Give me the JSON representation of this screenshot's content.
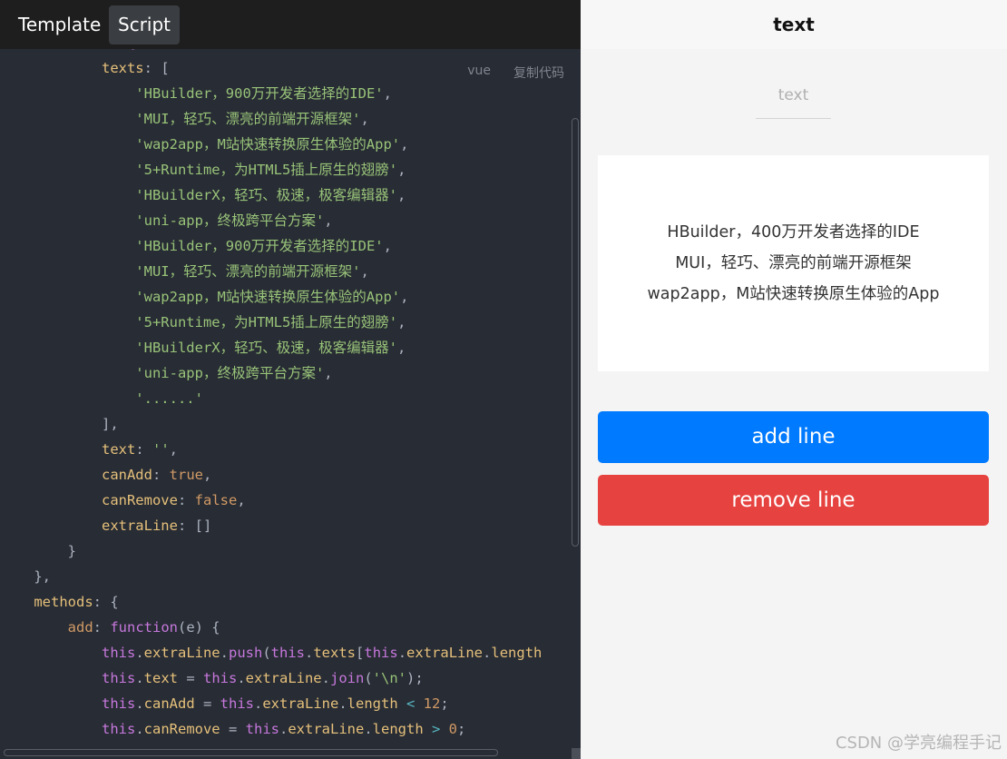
{
  "tabs": [
    {
      "label": "Template",
      "active": false
    },
    {
      "label": "Script",
      "active": true
    }
  ],
  "code_meta": {
    "language": "vue",
    "copy_label": "复制代码"
  },
  "code": {
    "lines": [
      [
        [
          "        return {",
          "tk-kw"
        ]
      ],
      [
        [
          "            ",
          ""
        ],
        [
          "texts",
          "tk-key"
        ],
        [
          ": [",
          "tk-punc"
        ]
      ],
      [
        [
          "                'HBuilder，900万开发者选择的IDE'",
          "tk-str"
        ],
        [
          ",",
          "tk-punc"
        ]
      ],
      [
        [
          "                'MUI，轻巧、漂亮的前端开源框架'",
          "tk-str"
        ],
        [
          ",",
          "tk-punc"
        ]
      ],
      [
        [
          "                'wap2app，M站快速转换原生体验的App'",
          "tk-str"
        ],
        [
          ",",
          "tk-punc"
        ]
      ],
      [
        [
          "                '5+Runtime，为HTML5插上原生的翅膀'",
          "tk-str"
        ],
        [
          ",",
          "tk-punc"
        ]
      ],
      [
        [
          "                'HBuilderX，轻巧、极速，极客编辑器'",
          "tk-str"
        ],
        [
          ",",
          "tk-punc"
        ]
      ],
      [
        [
          "                'uni-app，终极跨平台方案'",
          "tk-str"
        ],
        [
          ",",
          "tk-punc"
        ]
      ],
      [
        [
          "                'HBuilder，900万开发者选择的IDE'",
          "tk-str"
        ],
        [
          ",",
          "tk-punc"
        ]
      ],
      [
        [
          "                'MUI，轻巧、漂亮的前端开源框架'",
          "tk-str"
        ],
        [
          ",",
          "tk-punc"
        ]
      ],
      [
        [
          "                'wap2app，M站快速转换原生体验的App'",
          "tk-str"
        ],
        [
          ",",
          "tk-punc"
        ]
      ],
      [
        [
          "                '5+Runtime，为HTML5插上原生的翅膀'",
          "tk-str"
        ],
        [
          ",",
          "tk-punc"
        ]
      ],
      [
        [
          "                'HBuilderX，轻巧、极速，极客编辑器'",
          "tk-str"
        ],
        [
          ",",
          "tk-punc"
        ]
      ],
      [
        [
          "                'uni-app，终极跨平台方案'",
          "tk-str"
        ],
        [
          ",",
          "tk-punc"
        ]
      ],
      [
        [
          "                '......'",
          "tk-str"
        ]
      ],
      [
        [
          "            ],",
          "tk-punc"
        ]
      ],
      [
        [
          "            ",
          ""
        ],
        [
          "text",
          "tk-key"
        ],
        [
          ": ",
          "tk-punc"
        ],
        [
          "''",
          "tk-str"
        ],
        [
          ",",
          "tk-punc"
        ]
      ],
      [
        [
          "            ",
          ""
        ],
        [
          "canAdd",
          "tk-key"
        ],
        [
          ": ",
          "tk-punc"
        ],
        [
          "true",
          "tk-bool"
        ],
        [
          ",",
          "tk-punc"
        ]
      ],
      [
        [
          "            ",
          ""
        ],
        [
          "canRemove",
          "tk-key"
        ],
        [
          ": ",
          "tk-punc"
        ],
        [
          "false",
          "tk-bool"
        ],
        [
          ",",
          "tk-punc"
        ]
      ],
      [
        [
          "            ",
          ""
        ],
        [
          "extraLine",
          "tk-key"
        ],
        [
          ": []",
          "tk-punc"
        ]
      ],
      [
        [
          "        }",
          "tk-punc"
        ]
      ],
      [
        [
          "    },",
          "tk-punc"
        ]
      ],
      [
        [
          "    ",
          ""
        ],
        [
          "methods",
          "tk-key"
        ],
        [
          ": {",
          "tk-punc"
        ]
      ],
      [
        [
          "        ",
          ""
        ],
        [
          "add",
          "tk-meth"
        ],
        [
          ": ",
          "tk-punc"
        ],
        [
          "function",
          "tk-kw"
        ],
        [
          "(e) {",
          "tk-punc"
        ]
      ],
      [
        [
          "            ",
          ""
        ],
        [
          "this",
          "tk-kw"
        ],
        [
          ".",
          "tk-punc"
        ],
        [
          "extraLine",
          "tk-prop"
        ],
        [
          ".",
          "tk-punc"
        ],
        [
          "push",
          "tk-kw"
        ],
        [
          "(",
          "tk-punc"
        ],
        [
          "this",
          "tk-kw"
        ],
        [
          ".",
          "tk-punc"
        ],
        [
          "texts",
          "tk-prop"
        ],
        [
          "[",
          "tk-punc"
        ],
        [
          "this",
          "tk-kw"
        ],
        [
          ".",
          "tk-punc"
        ],
        [
          "extraLine",
          "tk-prop"
        ],
        [
          ".",
          "tk-punc"
        ],
        [
          "length",
          "tk-prop"
        ]
      ],
      [
        [
          "            ",
          ""
        ],
        [
          "this",
          "tk-kw"
        ],
        [
          ".",
          "tk-punc"
        ],
        [
          "text",
          "tk-prop"
        ],
        [
          " = ",
          "tk-punc"
        ],
        [
          "this",
          "tk-kw"
        ],
        [
          ".",
          "tk-punc"
        ],
        [
          "extraLine",
          "tk-prop"
        ],
        [
          ".",
          "tk-punc"
        ],
        [
          "join",
          "tk-kw"
        ],
        [
          "(",
          "tk-punc"
        ],
        [
          "'\\n'",
          "tk-str"
        ],
        [
          ");",
          "tk-punc"
        ]
      ],
      [
        [
          "            ",
          ""
        ],
        [
          "this",
          "tk-kw"
        ],
        [
          ".",
          "tk-punc"
        ],
        [
          "canAdd",
          "tk-prop"
        ],
        [
          " = ",
          "tk-punc"
        ],
        [
          "this",
          "tk-kw"
        ],
        [
          ".",
          "tk-punc"
        ],
        [
          "extraLine",
          "tk-prop"
        ],
        [
          ".",
          "tk-punc"
        ],
        [
          "length",
          "tk-prop"
        ],
        [
          " < ",
          "tk-op"
        ],
        [
          "12",
          "tk-num"
        ],
        [
          ";",
          "tk-punc"
        ]
      ],
      [
        [
          "            ",
          ""
        ],
        [
          "this",
          "tk-kw"
        ],
        [
          ".",
          "tk-punc"
        ],
        [
          "canRemove",
          "tk-prop"
        ],
        [
          " = ",
          "tk-punc"
        ],
        [
          "this",
          "tk-kw"
        ],
        [
          ".",
          "tk-punc"
        ],
        [
          "extraLine",
          "tk-prop"
        ],
        [
          ".",
          "tk-punc"
        ],
        [
          "length",
          "tk-prop"
        ],
        [
          " > ",
          "tk-op"
        ],
        [
          "0",
          "tk-num"
        ],
        [
          ";",
          "tk-punc"
        ]
      ]
    ]
  },
  "preview": {
    "nav_title": "text",
    "input": {
      "value": "",
      "placeholder": "text"
    },
    "text_lines": [
      "HBuilder，400万开发者选择的IDE",
      "MUI，轻巧、漂亮的前端开源框架",
      "wap2app，M站快速转换原生体验的App"
    ],
    "add_button": "add line",
    "remove_button": "remove line",
    "colors": {
      "add": "#007aff",
      "remove": "#e64340"
    }
  },
  "watermark": "CSDN @学亮编程手记"
}
